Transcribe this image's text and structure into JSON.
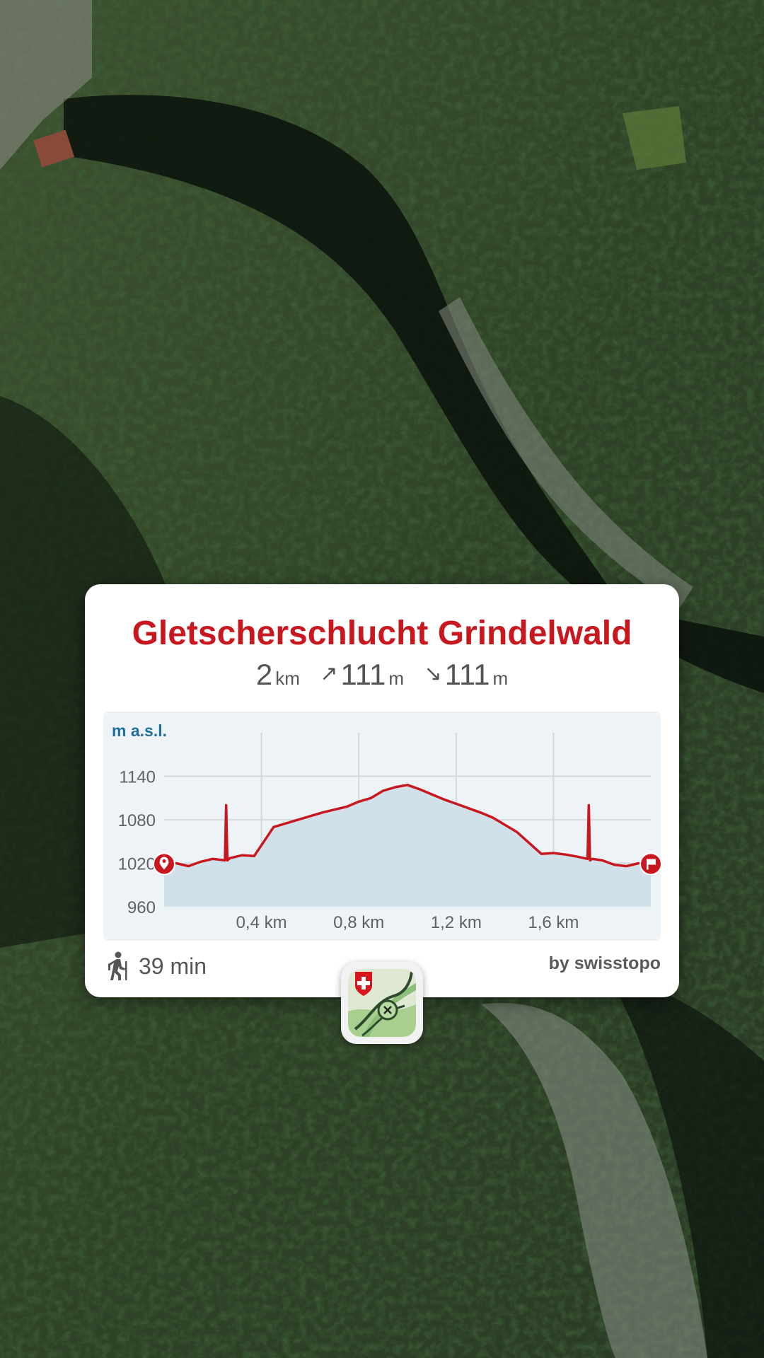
{
  "card": {
    "title": "Gletscherschlucht Grindelwald",
    "stats": {
      "distance_value": "2",
      "distance_unit": "km",
      "ascent_icon": "arrow-up-right-icon",
      "ascent_value": "111",
      "ascent_unit": "m",
      "descent_icon": "arrow-down-right-icon",
      "descent_value": "111",
      "descent_unit": "m"
    },
    "footer": {
      "time_icon": "hiker-icon",
      "time_label": "39 min",
      "credit": "by swisstopo"
    }
  },
  "app_badge_icon": "swisstopo-app-icon",
  "colors": {
    "accent_red": "#c8171e",
    "profile_fill": "#d0e1ea",
    "axis_title_blue": "#1f6f9c"
  },
  "chart_data": {
    "type": "area",
    "title": "",
    "ylabel": "m a.s.l.",
    "xlabel": "",
    "x_unit": "km",
    "ylim": [
      960,
      1200
    ],
    "xlim": [
      0,
      2.0
    ],
    "yticks": [
      "960",
      "1020",
      "1080",
      "1140"
    ],
    "xticks": [
      "0,4 km",
      "0,8 km",
      "1,2 km",
      "1,6 km"
    ],
    "xtick_values": [
      0.4,
      0.8,
      1.2,
      1.6
    ],
    "ytick_values": [
      960,
      1020,
      1080,
      1140
    ],
    "grid": true,
    "start_marker_icon": "location-pin-icon",
    "end_marker_icon": "flag-icon",
    "series": [
      {
        "x": [
          0,
          0.05,
          0.1,
          0.15,
          0.2,
          0.25,
          0.255,
          0.26,
          0.27,
          0.32,
          0.37,
          0.45,
          0.55,
          0.65,
          0.7,
          0.75,
          0.8,
          0.85,
          0.9,
          0.95,
          1.0,
          1.05,
          1.1,
          1.15,
          1.2,
          1.25,
          1.3,
          1.35,
          1.45,
          1.55,
          1.6,
          1.65,
          1.7,
          1.74,
          1.745,
          1.75,
          1.76,
          1.8,
          1.85,
          1.9,
          1.95,
          2.0
        ],
        "y": [
          1019,
          1020,
          1016,
          1022,
          1026,
          1024,
          1100,
          1024,
          1027,
          1031,
          1030,
          1070,
          1080,
          1090,
          1094,
          1098,
          1105,
          1110,
          1120,
          1125,
          1128,
          1122,
          1115,
          1108,
          1102,
          1096,
          1090,
          1083,
          1063,
          1033,
          1034,
          1032,
          1029,
          1026,
          1100,
          1024,
          1026,
          1024,
          1018,
          1016,
          1020,
          1019
        ]
      }
    ]
  }
}
